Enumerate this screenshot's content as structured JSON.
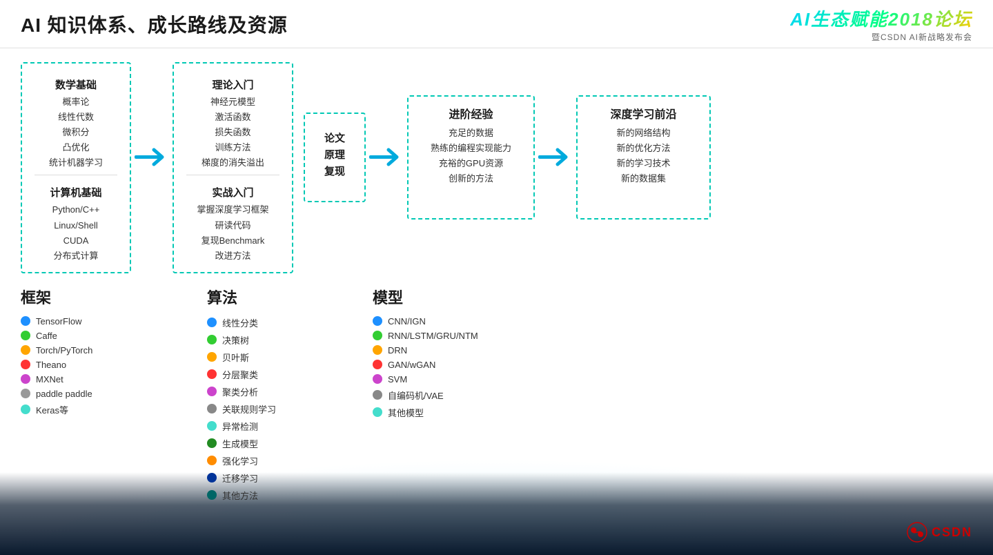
{
  "header": {
    "title": "AI 知识体系、成长路线及资源",
    "logo_main": "AI生态赋能2018论坛",
    "logo_sub": "暨CSDN AI新战略发布会"
  },
  "roadmap": {
    "box1": {
      "title1": "数学基础",
      "items1": [
        "概率论",
        "线性代数",
        "微积分",
        "凸优化",
        "统计机器学习"
      ],
      "title2": "计算机基础",
      "items2": [
        "Python/C++",
        "Linux/Shell",
        "CUDA",
        "分布式计算"
      ]
    },
    "box2": {
      "title1": "理论入门",
      "items1": [
        "神经元模型",
        "激活函数",
        "损失函数",
        "训练方法",
        "梯度的消失溢出"
      ],
      "title2": "实战入门",
      "items2": [
        "掌握深度学习框架",
        "研读代码",
        "复现Benchmark",
        "改进方法"
      ]
    },
    "box3": {
      "title": "论文\n原理\n复现"
    },
    "box4": {
      "title": "进阶经验",
      "items": [
        "充足的数据",
        "熟练的编程实现能力",
        "充裕的GPU资源",
        "创新的方法"
      ]
    },
    "box5": {
      "title": "深度学习前沿",
      "items": [
        "新的网络结构",
        "新的优化方法",
        "新的学习技术",
        "新的数据集"
      ]
    }
  },
  "frameworks": {
    "label": "框架",
    "items": [
      {
        "color": "#1E90FF",
        "name": "TensorFlow"
      },
      {
        "color": "#32CD32",
        "name": "Caffe"
      },
      {
        "color": "#FFA500",
        "name": "Torch/PyTorch"
      },
      {
        "color": "#FF3333",
        "name": "Theano"
      },
      {
        "color": "#CC44CC",
        "name": "MXNet"
      },
      {
        "color": "#999999",
        "name": "paddle paddle"
      },
      {
        "color": "#44DDCC",
        "name": "Keras等"
      }
    ]
  },
  "algorithms": {
    "label": "算法",
    "items": [
      {
        "color": "#1E90FF",
        "name": "线性分类"
      },
      {
        "color": "#32CD32",
        "name": "决策树"
      },
      {
        "color": "#FFA500",
        "name": "贝叶斯"
      },
      {
        "color": "#FF3333",
        "name": "分层聚类"
      },
      {
        "color": "#CC44CC",
        "name": "聚类分析"
      },
      {
        "color": "#888888",
        "name": "关联规则学习"
      },
      {
        "color": "#44DDCC",
        "name": "异常检测"
      },
      {
        "color": "#228B22",
        "name": "生成模型"
      },
      {
        "color": "#FF8C00",
        "name": "强化学习"
      },
      {
        "color": "#003399",
        "name": "迁移学习"
      },
      {
        "color": "#006666",
        "name": "其他方法"
      }
    ]
  },
  "models": {
    "label": "模型",
    "items": [
      {
        "color": "#1E90FF",
        "name": "CNN/IGN"
      },
      {
        "color": "#32CD32",
        "name": "RNN/LSTM/GRU/NTM"
      },
      {
        "color": "#FFA500",
        "name": "DRN"
      },
      {
        "color": "#FF3333",
        "name": "GAN/wGAN"
      },
      {
        "color": "#CC44CC",
        "name": "SVM"
      },
      {
        "color": "#888888",
        "name": "自编码机/VAE"
      },
      {
        "color": "#44DDCC",
        "name": "其他模型"
      }
    ]
  },
  "csdn": {
    "logo": "CSDN"
  }
}
